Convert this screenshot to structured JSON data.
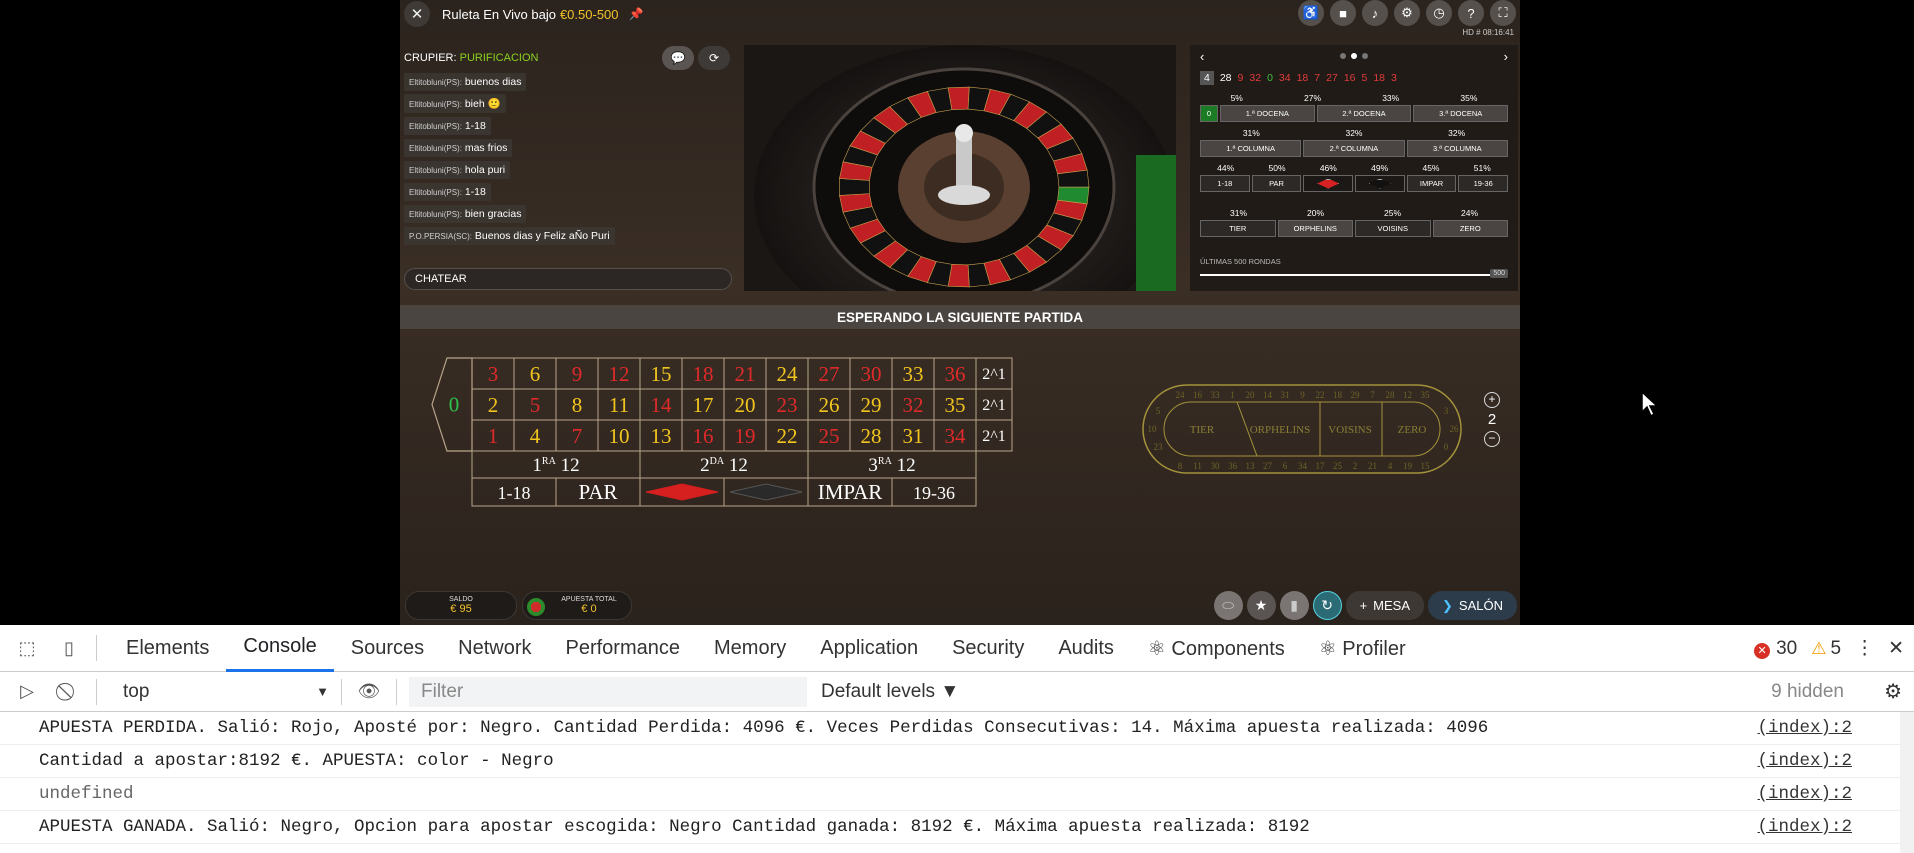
{
  "game": {
    "title": "Ruleta En Vivo bajo",
    "limits": "€0.50-500",
    "hd_info": "HD  # 08:16:41",
    "top_icons": [
      "accessibility-icon",
      "camera-icon",
      "sound-icon",
      "settings-icon",
      "history-icon",
      "help-icon",
      "fullscreen-icon"
    ],
    "dealer_label": "CRUPIER:",
    "dealer_name": "PURIFICACION",
    "chat": [
      {
        "user": "Eltitobluni(PS):",
        "text": "buenos dias"
      },
      {
        "user": "Eltitobluni(PS):",
        "text": "bieh 🙂"
      },
      {
        "user": "Eltitobluni(PS):",
        "text": "1-18"
      },
      {
        "user": "Eltitobluni(PS):",
        "text": "mas frios"
      },
      {
        "user": "Eltitobluni(PS):",
        "text": "hola puri"
      },
      {
        "user": "Eltitobluni(PS):",
        "text": "1-18"
      },
      {
        "user": "Eltitobluni(PS):",
        "text": "bien gracias"
      },
      {
        "user": "P.O.PERSIA(SC):",
        "text": "Buenos dias y Feliz aÑo Puri"
      }
    ],
    "chat_placeholder": "CHATEAR",
    "stats": {
      "last_numbers": [
        {
          "n": "4",
          "c": "#ffffff"
        },
        {
          "n": "28",
          "c": "#ffffff"
        },
        {
          "n": "9",
          "c": "#e23b3b"
        },
        {
          "n": "32",
          "c": "#e23b3b"
        },
        {
          "n": "0",
          "c": "#3fbf3f"
        },
        {
          "n": "34",
          "c": "#e23b3b"
        },
        {
          "n": "18",
          "c": "#e23b3b"
        },
        {
          "n": "7",
          "c": "#e23b3b"
        },
        {
          "n": "27",
          "c": "#e23b3b"
        },
        {
          "n": "16",
          "c": "#e23b3b"
        },
        {
          "n": "5",
          "c": "#e23b3b"
        },
        {
          "n": "18",
          "c": "#e23b3b"
        },
        {
          "n": "3",
          "c": "#e23b3b"
        }
      ],
      "dozens_pct": [
        "5%",
        "27%",
        "33%",
        "35%"
      ],
      "dozens": [
        "0",
        "1.ª DOCENA",
        "2.ª DOCENA",
        "3.ª DOCENA"
      ],
      "columns_pct": [
        "31%",
        "32%",
        "32%"
      ],
      "columns": [
        "1.ª COLUMNA",
        "2.ª COLUMNA",
        "3.ª COLUMNA"
      ],
      "even_pct": [
        "44%",
        "50%",
        "46%",
        "49%",
        "45%",
        "51%"
      ],
      "even": [
        "1-18",
        "PAR",
        "",
        "",
        "IMPAR",
        "19-36"
      ],
      "sectors_pct": [
        "31%",
        "20%",
        "25%",
        "24%"
      ],
      "sectors": [
        "TIER",
        "ORPHELINS",
        "VOISINS",
        "ZERO"
      ],
      "rounds_label": "ÚLTIMAS 500 RONDAS",
      "rounds_value": "500"
    },
    "waiting_text": "ESPERANDO LA SIGUIENTE PARTIDA",
    "table": {
      "zero": "0",
      "rows": [
        [
          {
            "n": "3",
            "c": "r"
          },
          {
            "n": "6",
            "c": "y"
          },
          {
            "n": "9",
            "c": "r"
          },
          {
            "n": "12",
            "c": "r"
          },
          {
            "n": "15",
            "c": "y"
          },
          {
            "n": "18",
            "c": "r"
          },
          {
            "n": "21",
            "c": "r"
          },
          {
            "n": "24",
            "c": "y"
          },
          {
            "n": "27",
            "c": "r"
          },
          {
            "n": "30",
            "c": "r"
          },
          {
            "n": "33",
            "c": "y"
          },
          {
            "n": "36",
            "c": "r"
          }
        ],
        [
          {
            "n": "2",
            "c": "y"
          },
          {
            "n": "5",
            "c": "r"
          },
          {
            "n": "8",
            "c": "y"
          },
          {
            "n": "11",
            "c": "y"
          },
          {
            "n": "14",
            "c": "r"
          },
          {
            "n": "17",
            "c": "y"
          },
          {
            "n": "20",
            "c": "y"
          },
          {
            "n": "23",
            "c": "r"
          },
          {
            "n": "26",
            "c": "y"
          },
          {
            "n": "29",
            "c": "y"
          },
          {
            "n": "32",
            "c": "r"
          },
          {
            "n": "35",
            "c": "y"
          }
        ],
        [
          {
            "n": "1",
            "c": "r"
          },
          {
            "n": "4",
            "c": "y"
          },
          {
            "n": "7",
            "c": "r"
          },
          {
            "n": "10",
            "c": "y"
          },
          {
            "n": "13",
            "c": "y"
          },
          {
            "n": "16",
            "c": "r"
          },
          {
            "n": "19",
            "c": "r"
          },
          {
            "n": "22",
            "c": "y"
          },
          {
            "n": "25",
            "c": "r"
          },
          {
            "n": "28",
            "c": "y"
          },
          {
            "n": "31",
            "c": "y"
          },
          {
            "n": "34",
            "c": "r"
          }
        ]
      ],
      "column_bet": "2^1",
      "dozens": [
        {
          "base": "1",
          "sup": "RA",
          "rest": " 12"
        },
        {
          "base": "2",
          "sup": "DA",
          "rest": " 12"
        },
        {
          "base": "3",
          "sup": "RA",
          "rest": " 12"
        }
      ],
      "outside": [
        "1-18",
        "PAR",
        "",
        "",
        "IMPAR",
        "19-36"
      ]
    },
    "racetrack": {
      "top": [
        "24",
        "16",
        "33",
        "1",
        "20",
        "14",
        "31",
        "9",
        "22",
        "18",
        "29",
        "7",
        "28",
        "12",
        "35"
      ],
      "bottom": [
        "8",
        "11",
        "30",
        "36",
        "13",
        "27",
        "6",
        "34",
        "17",
        "25",
        "2",
        "21",
        "4",
        "19",
        "15"
      ],
      "left": [
        "5",
        "10",
        "23"
      ],
      "right": [
        "3",
        "26",
        "0"
      ],
      "sectors": [
        "TIER",
        "ORPHELINS",
        "VOISINS",
        "ZERO"
      ]
    },
    "zoom_value": "2",
    "balance_label": "SALDO",
    "balance_value": "€ 95",
    "total_bet_label": "APUESTA TOTAL",
    "total_bet_value": "€ 0",
    "mesa_label": "MESA",
    "salon_label": "SALÓN"
  },
  "devtools": {
    "tabs": [
      "Elements",
      "Console",
      "Sources",
      "Network",
      "Performance",
      "Memory",
      "Application",
      "Security",
      "Audits",
      "⚛ Components",
      "⚛ Profiler"
    ],
    "active_tab": "Console",
    "errors": "30",
    "warnings": "5",
    "context": "top",
    "filter_placeholder": "Filter",
    "levels": "Default levels ▼",
    "hidden": "9 hidden",
    "lines": [
      {
        "msg": "APUESTA PERDIDA. Salió: Rojo, Aposté por: Negro. Cantidad Perdida: 4096 €. Veces Perdidas Consecutivas: 14. Máxima apuesta realizada: 4096",
        "src": "(index):2"
      },
      {
        "msg": "Cantidad a apostar:8192 €. APUESTA: color - Negro",
        "src": "(index):2"
      },
      {
        "msg": "undefined",
        "src": "(index):2"
      },
      {
        "msg": "APUESTA GANADA. Salió: Negro, Opcion para apostar escogida: Negro Cantidad ganada: 8192 €. Máxima apuesta realizada: 8192",
        "src": "(index):2"
      }
    ]
  }
}
